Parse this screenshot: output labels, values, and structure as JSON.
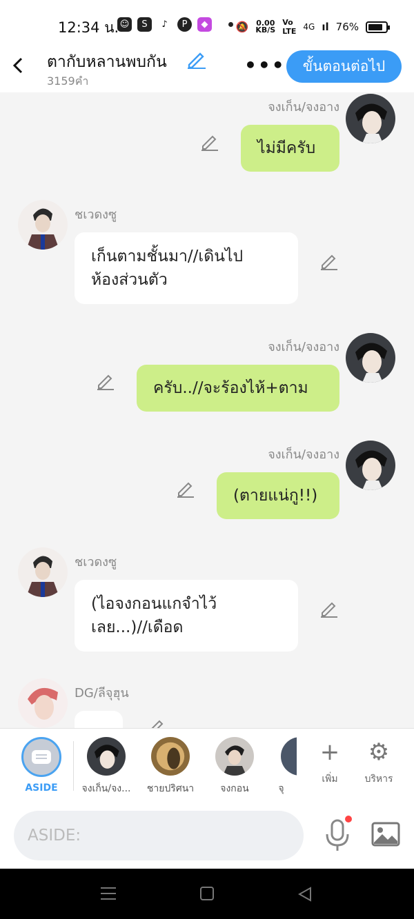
{
  "status_bar": {
    "time": "12:34 น.",
    "speed": "0.00\nKB/S",
    "signal": "4G",
    "battery": "76%"
  },
  "header": {
    "title": "ตากับหลานพบกัน",
    "word_count": "3159คำ",
    "more": "•••",
    "next_button": "ขั้นตอนต่อไป"
  },
  "messages": [
    {
      "side": "right",
      "speaker": "จงเก็น/จงอาง",
      "text": "ไม่มีครับ"
    },
    {
      "side": "left",
      "speaker": "ชเวดงซู",
      "text_line1": "เก็นตามชั้นมา//เดินไป",
      "text_line2": "ห้องส่วนตัว"
    },
    {
      "side": "right",
      "speaker": "จงเก็น/จงอาง",
      "text": "ครับ..//จะร้องไห้+ตาม"
    },
    {
      "side": "right",
      "speaker": "จงเก็น/จงอาง",
      "text": "(ตายแน่กู!!)"
    },
    {
      "side": "left",
      "speaker": "ชเวดงซู",
      "text_line1": "(ไอจงกอนแกจำไว้",
      "text_line2": "เลย...)//เดือด"
    },
    {
      "side": "left",
      "speaker": "DG/ลีจุฮุน",
      "text": ""
    }
  ],
  "characters": [
    {
      "label": "ASIDE",
      "icon": "aside-icon"
    },
    {
      "label": "จงเก็น/จง..."
    },
    {
      "label": "ชายปริศนา"
    },
    {
      "label": "จงกอน"
    },
    {
      "label": "จุ"
    }
  ],
  "tools": {
    "add_label": "เพิ่ม",
    "manage_label": "บริหาร"
  },
  "input": {
    "placeholder": "ASIDE:"
  },
  "colors": {
    "accent": "#3b9cf6",
    "bubble_right": "#cdee89",
    "bubble_left": "#ffffff",
    "background": "#f4f4f4"
  }
}
